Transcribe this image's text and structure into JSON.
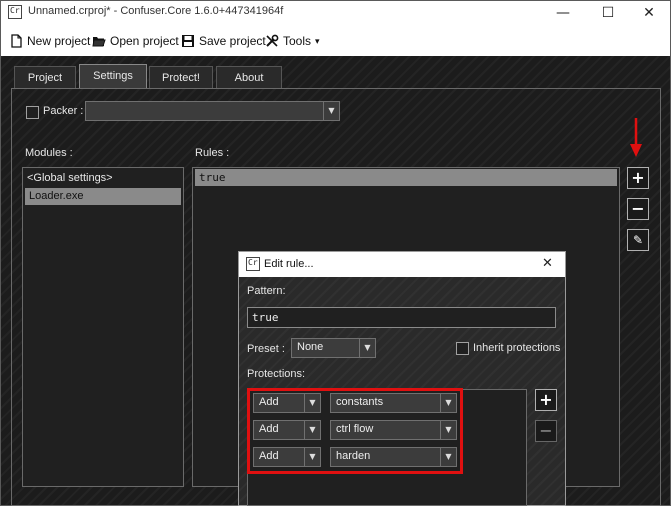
{
  "window": {
    "title": "Unnamed.crproj* - Confuser.Core 1.6.0+447341964f",
    "icon_text": "Cr",
    "controls": {
      "minimize": "—",
      "maximize": "☐",
      "close": "✕"
    }
  },
  "toolbar": {
    "new_project": "New project",
    "open_project": "Open project",
    "save_project": "Save project",
    "tools": "Tools",
    "tools_arrow": "▾"
  },
  "tabs": [
    {
      "label": "Project"
    },
    {
      "label": "Settings",
      "active": true
    },
    {
      "label": "Protect!"
    },
    {
      "label": "About"
    }
  ],
  "settings": {
    "packer_label": "Packer :",
    "packer_value": "",
    "modules_label": "Modules :",
    "rules_label": "Rules :",
    "modules": [
      "<Global settings>",
      "Loader.exe"
    ],
    "rules": [
      "true"
    ],
    "buttons": {
      "add": "+",
      "remove": "−",
      "edit": "✎"
    }
  },
  "edit_rule": {
    "title": "Edit rule...",
    "icon_text": "Cr",
    "close": "✕",
    "pattern_label": "Pattern:",
    "pattern_value": "true",
    "preset_label": "Preset :",
    "preset_value": "None",
    "inherit_label": "Inherit protections",
    "protections_label": "Protections:",
    "protections": [
      {
        "action": "Add",
        "name": "constants"
      },
      {
        "action": "Add",
        "name": "ctrl flow"
      },
      {
        "action": "Add",
        "name": "harden"
      }
    ],
    "add_button": "+",
    "remove_button": "−"
  },
  "colors": {
    "highlight": "#e01010",
    "annotation_arrow": "#e01010"
  }
}
